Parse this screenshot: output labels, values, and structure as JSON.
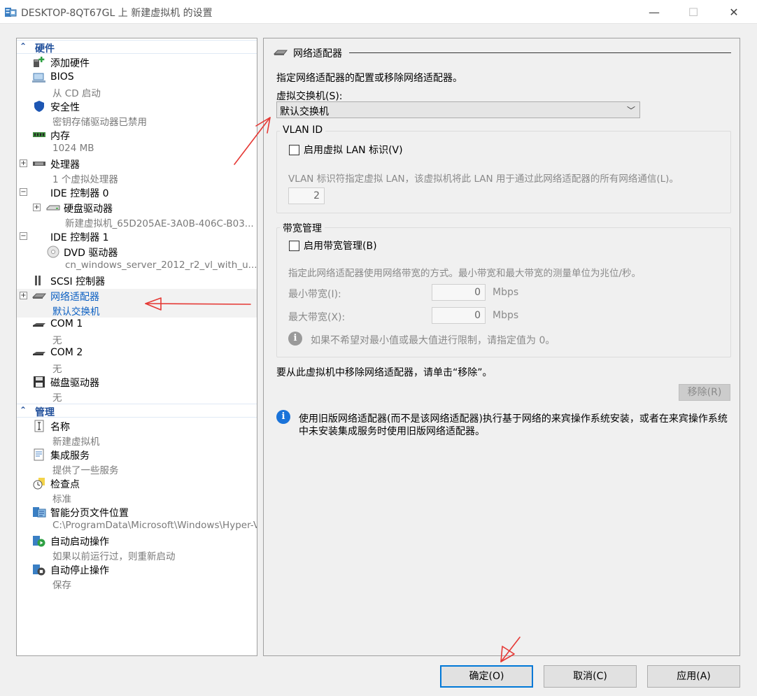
{
  "window": {
    "title": "DESKTOP-8QT67GL 上 新建虚拟机 的设置",
    "controls": {
      "minimize": "—",
      "maximize": "☐",
      "close": "✕"
    }
  },
  "sidebar": {
    "hardware_header": "硬件",
    "management_header": "管理",
    "hardware_items": [
      {
        "label": "添加硬件",
        "sub": "",
        "icon": "add-hardware-icon"
      },
      {
        "label": "BIOS",
        "sub": "从 CD 启动",
        "icon": "bios-icon"
      },
      {
        "label": "安全性",
        "sub": "密钥存储驱动器已禁用",
        "icon": "security-shield-icon"
      },
      {
        "label": "内存",
        "sub": "1024 MB",
        "icon": "memory-icon"
      },
      {
        "label": "处理器",
        "sub": "1 个虚拟处理器",
        "icon": "processor-icon",
        "expander": "+"
      },
      {
        "label": "IDE 控制器 0",
        "sub": "",
        "expander": "−"
      },
      {
        "label": "硬盘驱动器",
        "sub": "新建虚拟机_65D205AE-3A0B-406C-B03...",
        "icon": "hard-drive-icon",
        "expander": "+"
      },
      {
        "label": "IDE 控制器 1",
        "sub": "",
        "expander": "−"
      },
      {
        "label": "DVD 驱动器",
        "sub": "cn_windows_server_2012_r2_vl_with_u...",
        "icon": "dvd-drive-icon"
      },
      {
        "label": "SCSI 控制器",
        "sub": "",
        "icon": "scsi-controller-icon"
      },
      {
        "label": "网络适配器",
        "sub": "默认交换机",
        "icon": "network-adapter-icon",
        "expander": "+"
      },
      {
        "label": "COM 1",
        "sub": "无",
        "icon": "com-port-icon"
      },
      {
        "label": "COM 2",
        "sub": "无",
        "icon": "com-port-icon"
      },
      {
        "label": "磁盘驱动器",
        "sub": "无",
        "icon": "floppy-disk-icon"
      }
    ],
    "management_items": [
      {
        "label": "名称",
        "sub": "新建虚拟机",
        "icon": "name-icon"
      },
      {
        "label": "集成服务",
        "sub": "提供了一些服务",
        "icon": "integration-services-icon"
      },
      {
        "label": "检查点",
        "sub": "标准",
        "icon": "checkpoint-icon"
      },
      {
        "label": "智能分页文件位置",
        "sub": "C:\\ProgramData\\Microsoft\\Windows\\Hyper-V",
        "icon": "paging-file-icon"
      },
      {
        "label": "自动启动操作",
        "sub": "如果以前运行过，则重新启动",
        "icon": "auto-start-icon"
      },
      {
        "label": "自动停止操作",
        "sub": "保存",
        "icon": "auto-stop-icon"
      }
    ]
  },
  "main": {
    "section_title": "网络适配器",
    "description": "指定网络适配器的配置或移除网络适配器。",
    "switch_label": "虚拟交换机(S):",
    "switch_value": "默认交换机",
    "vlan": {
      "title": "VLAN ID",
      "checkbox_label": "启用虚拟 LAN 标识(V)",
      "help": "VLAN 标识符指定虚拟 LAN，该虚拟机将此 LAN 用于通过此网络适配器的所有网络通信(L)。",
      "value": "2"
    },
    "bandwidth": {
      "title": "带宽管理",
      "checkbox_label": "启用带宽管理(B)",
      "help": "指定此网络适配器使用网络带宽的方式。最小带宽和最大带宽的测量单位为兆位/秒。",
      "min_label": "最小带宽(I):",
      "min_value": "0",
      "max_label": "最大带宽(X):",
      "max_value": "0",
      "unit": "Mbps",
      "hint": "如果不希望对最小值或最大值进行限制，请指定值为 0。"
    },
    "remove_text": "要从此虚拟机中移除网络适配器，请单击“移除”。",
    "remove_button": "移除(R)",
    "info_line1": "使用旧版网络适配器(而不是该网络适配器)执行基于网络的来宾操作系统安装，或者在来宾操作系统",
    "info_line2": "中未安装集成服务时使用旧版网络适配器。"
  },
  "footer": {
    "ok": "确定(O)",
    "cancel": "取消(C)",
    "apply": "应用(A)"
  },
  "colors": {
    "accent": "#0078d7",
    "selected_text": "#0b5fc2",
    "annotation_arrow": "#e53935"
  }
}
